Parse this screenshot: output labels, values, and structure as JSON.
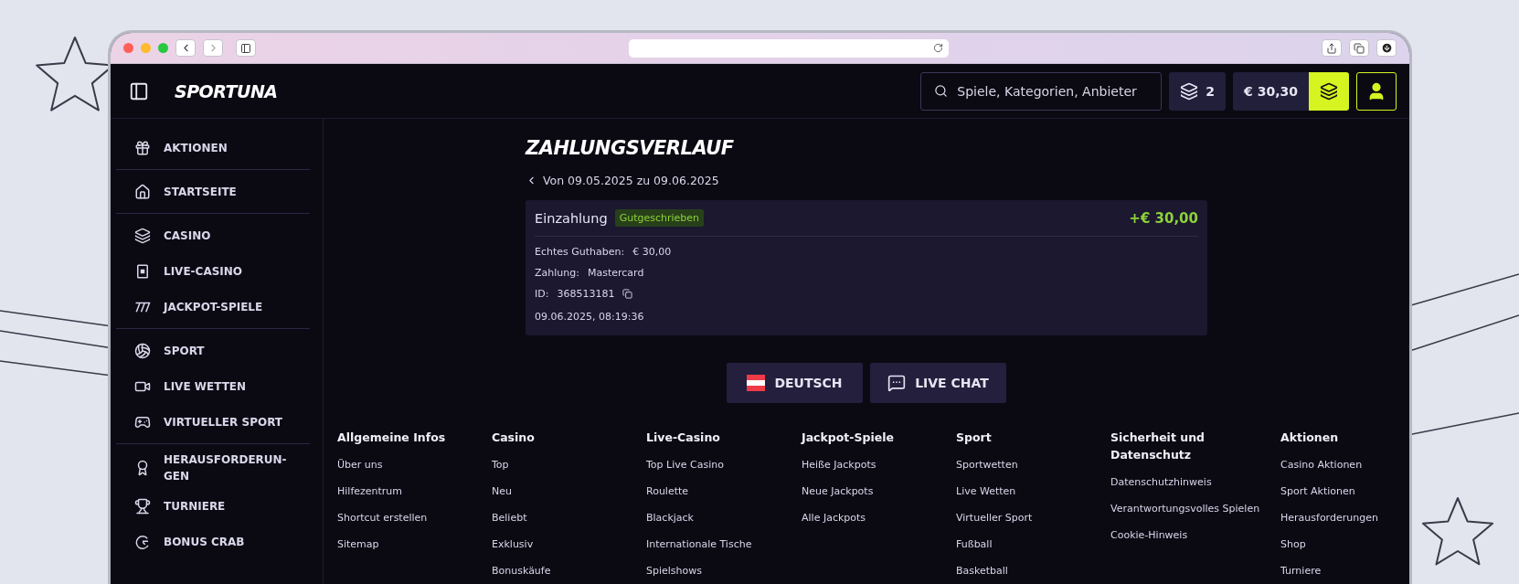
{
  "header": {
    "logo": "SPORTUNA",
    "search": {
      "placeholder": "Spiele, Kategorien, Anbieter"
    },
    "coins": "2",
    "balance": "€ 30,30"
  },
  "sidebar": {
    "sections": [
      {
        "items": [
          "AKTIONEN"
        ]
      },
      {
        "items": [
          "STARTSEITE"
        ]
      },
      {
        "items": [
          "CASINO",
          "LIVE-CASINO",
          "JACKPOT-SPIELE"
        ]
      },
      {
        "items": [
          "SPORT",
          "LIVE WETTEN",
          "VIRTUELLER SPORT"
        ]
      },
      {
        "items": [
          "HERAUSFORDERUN-GEN",
          "TURNIERE",
          "BONUS CRAB"
        ]
      }
    ]
  },
  "content": {
    "title": "ZAHLUNGSVERLAUF",
    "date_range": "Von 09.05.2025 zu 09.06.2025",
    "transaction": {
      "type": "Einzahlung",
      "status": "Gutgeschrieben",
      "amount": "+€ 30,00",
      "details": [
        {
          "label": "Echtes Guthaben:",
          "value": "€ 30,00"
        },
        {
          "label": "Zahlung:",
          "value": "Mastercard"
        },
        {
          "label": "ID:",
          "value": "368513181",
          "copyable": true
        }
      ],
      "datetime": "09.06.2025, 08:19:36"
    },
    "buttons": [
      {
        "kind": "language",
        "label": "DEUTSCH"
      },
      {
        "kind": "chat",
        "label": "LIVE CHAT"
      }
    ]
  },
  "footer": {
    "columns": [
      {
        "heading": "Allgemeine Infos",
        "links": [
          "Über uns",
          "Hilfezentrum",
          "Shortcut erstellen",
          "Sitemap"
        ]
      },
      {
        "heading": "Casino",
        "links": [
          "Top",
          "Neu",
          "Beliebt",
          "Exklusiv",
          "Bonuskäufe"
        ]
      },
      {
        "heading": "Live-Casino",
        "links": [
          "Top Live Casino",
          "Roulette",
          "Blackjack",
          "Internationale Tische",
          "Spielshows"
        ]
      },
      {
        "heading": "Jackpot-Spiele",
        "links": [
          "Heiße Jackpots",
          "Neue Jackpots",
          "Alle Jackpots"
        ]
      },
      {
        "heading": "Sport",
        "links": [
          "Sportwetten",
          "Live Wetten",
          "Virtueller Sport",
          "Fußball",
          "Basketball"
        ]
      },
      {
        "heading": "Sicherheit und Datenschutz",
        "links": [
          "Datenschutzhinweis",
          "Verantwortungsvolles Spielen",
          "Cookie-Hinweis"
        ]
      },
      {
        "heading": "Aktionen",
        "links": [
          "Casino Aktionen",
          "Sport Aktionen",
          "Herausforderungen",
          "Shop",
          "Turniere"
        ]
      }
    ]
  }
}
